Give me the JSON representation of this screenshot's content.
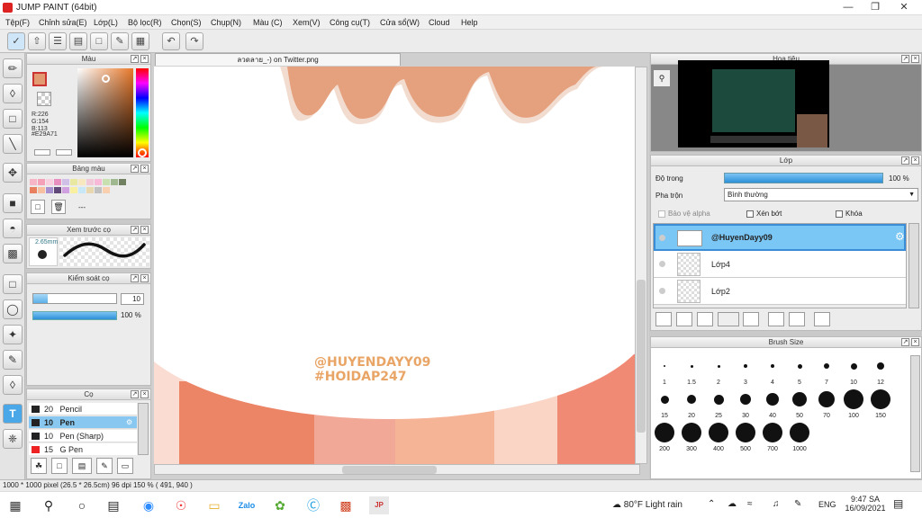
{
  "app": {
    "title": "JUMP PAINT (64bit)"
  },
  "menu": [
    "Tệp(F)",
    "Chỉnh sửa(E)",
    "Lớp(L)",
    "Bộ lọc(R)",
    "Chọn(S)",
    "Chụp(N)",
    "Màu (C)",
    "Xem(V)",
    "Công cụ(T)",
    "Cửa sổ(W)",
    "Cloud",
    "Help"
  ],
  "color_panel": {
    "title": "Màu",
    "r": "R:226",
    "g": "G:154",
    "b": "B:113",
    "hex": "#E29A71",
    "main_color": "#E29A71"
  },
  "palette_panel": {
    "title": "Bảng màu",
    "name": "---"
  },
  "brush_preview": {
    "title": "Xem trước cọ",
    "size": "2.65mm"
  },
  "brush_control": {
    "title": "Kiểm soát cọ",
    "size": "10",
    "opacity": "100 %"
  },
  "brushes_panel": {
    "title": "Cọ",
    "items": [
      {
        "size": "20",
        "name": "Pencil"
      },
      {
        "size": "10",
        "name": "Pen"
      },
      {
        "size": "10",
        "name": "Pen (Sharp)"
      },
      {
        "size": "15",
        "name": "G Pen"
      }
    ]
  },
  "document": {
    "tab": "ลวดลาย_-) on Twitter.png",
    "watermark1": "@HUYENDAYY09",
    "watermark2": "#HOIDAP247"
  },
  "navigator": {
    "title": "Hoa tiêu"
  },
  "layers": {
    "title": "Lớp",
    "opacity_label": "Độ trong",
    "opacity_value": "100 %",
    "blend_label": "Pha trộn",
    "blend_value": "Bình thường",
    "protect_alpha": "Bảo vệ alpha",
    "clipping": "Xén bớt",
    "lock": "Khóa",
    "items": [
      {
        "name": "@HuyenDayy09"
      },
      {
        "name": "Lớp4"
      },
      {
        "name": "Lớp2"
      }
    ]
  },
  "brush_size": {
    "title": "Brush Size",
    "sizes": [
      "1",
      "1.5",
      "2",
      "3",
      "4",
      "5",
      "7",
      "10",
      "12",
      "15",
      "20",
      "25",
      "30",
      "40",
      "50",
      "70",
      "100",
      "150",
      "200",
      "300",
      "400",
      "500",
      "700",
      "1000"
    ]
  },
  "status": {
    "text": "1000 * 1000 pixel   (26.5 * 26.5cm)   96 dpi   150 %   ( 491, 940 )"
  },
  "taskbar": {
    "weather": "80°F  Light rain",
    "lang": "ENG",
    "time": "9:47 SA",
    "date": "16/09/2021"
  }
}
